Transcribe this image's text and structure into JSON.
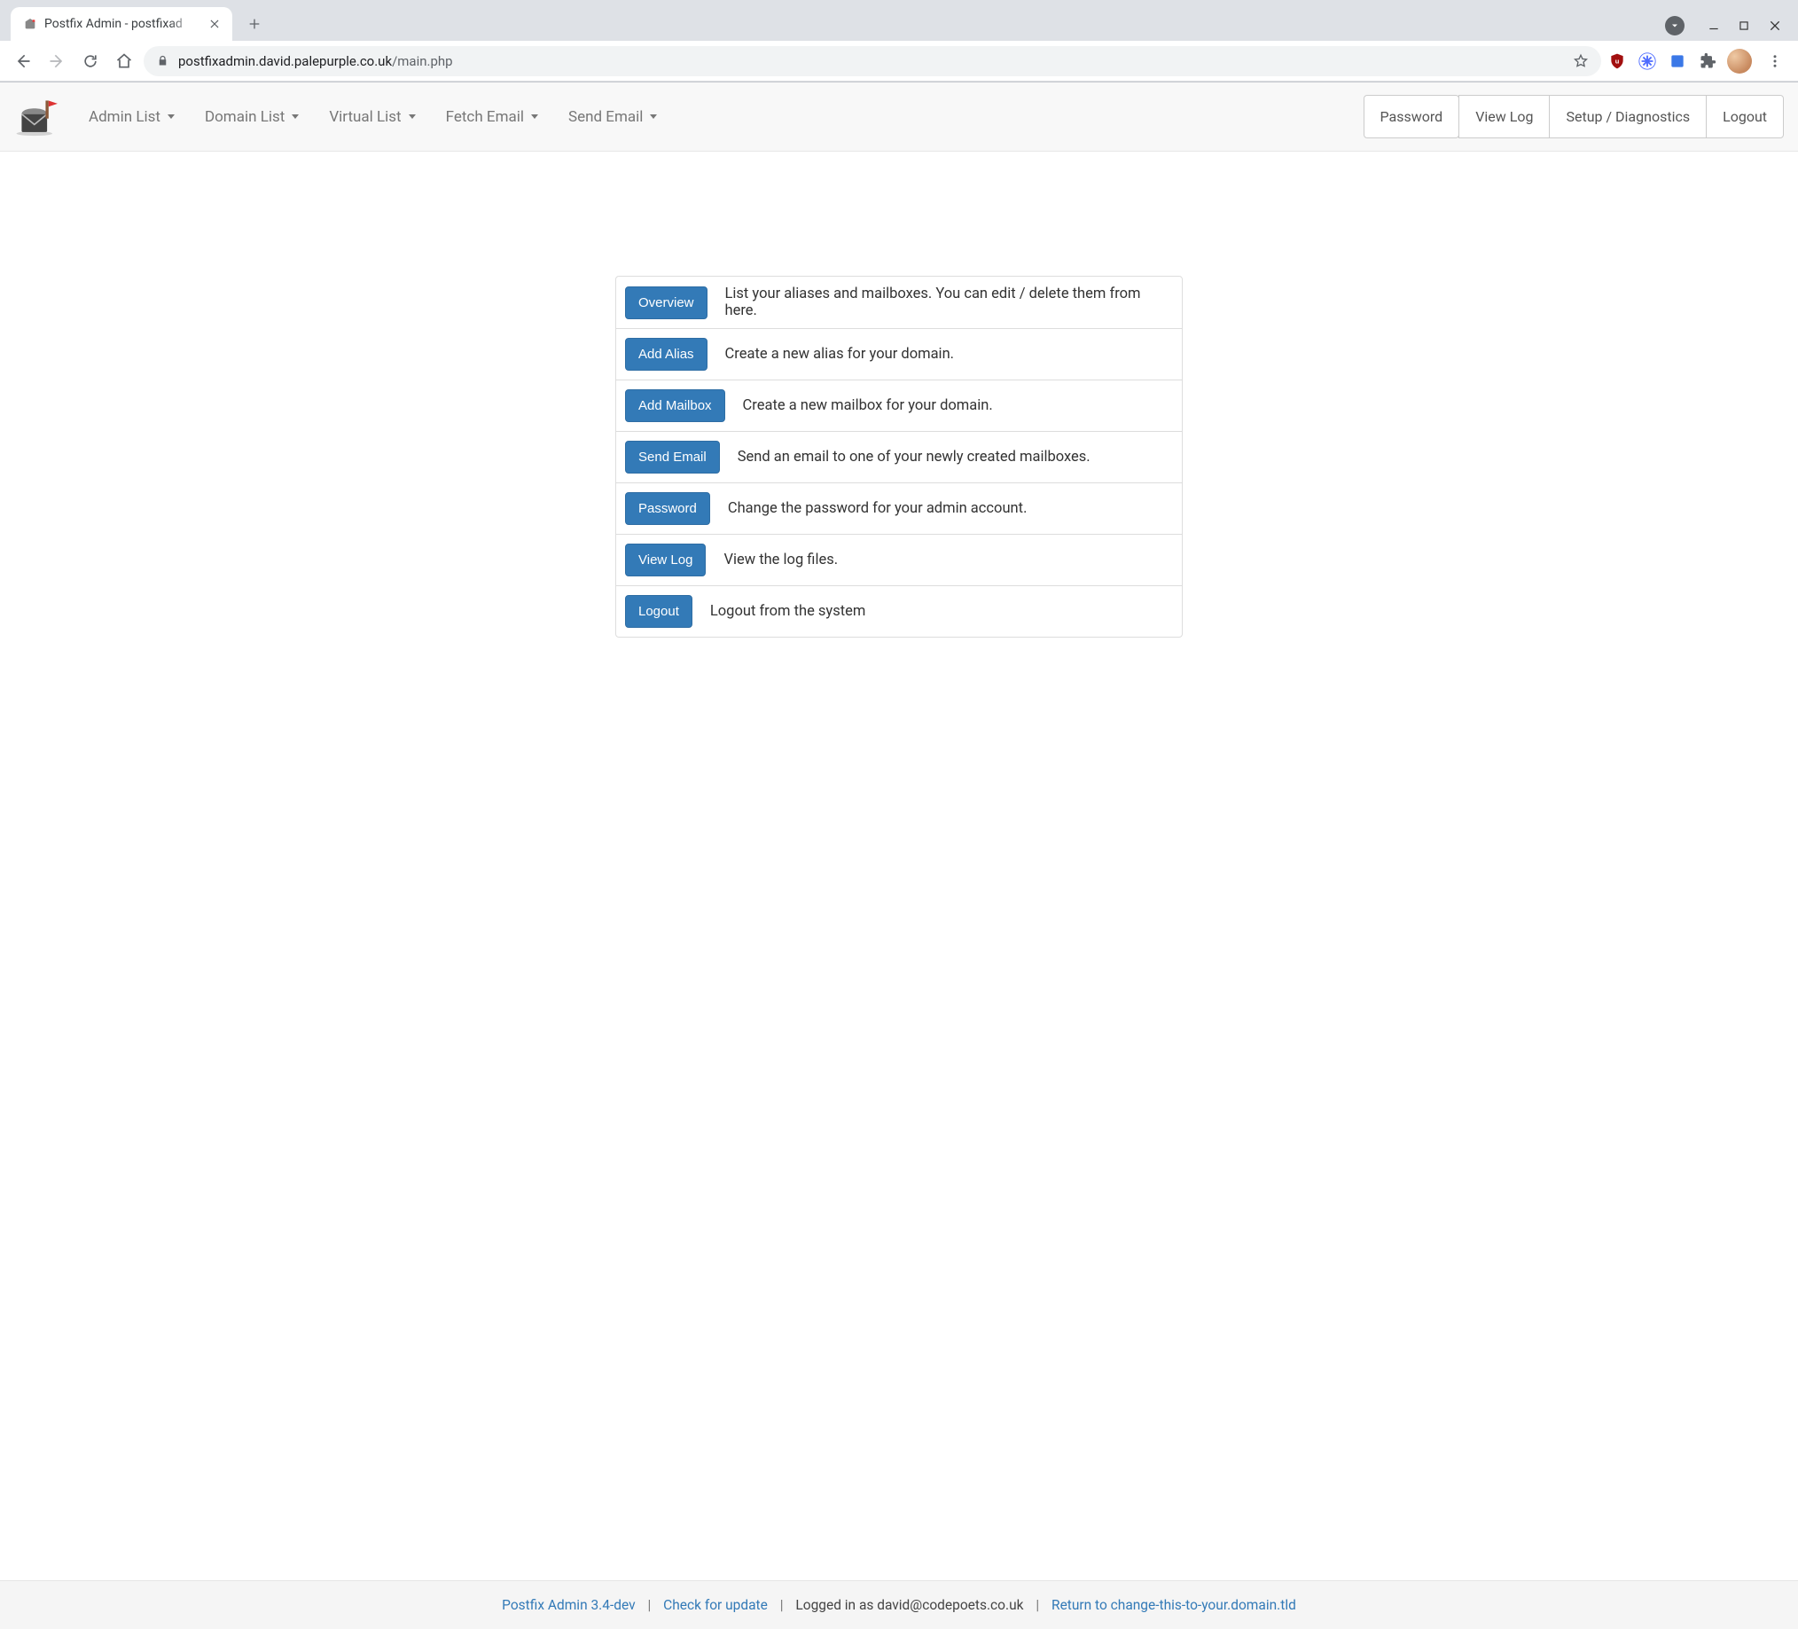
{
  "browser": {
    "tab_title": "Postfix Admin - postfixad",
    "url_host": "postfixadmin.david.palepurple.co.uk",
    "url_path": "/main.php"
  },
  "navbar": {
    "items": [
      {
        "label": "Admin List"
      },
      {
        "label": "Domain List"
      },
      {
        "label": "Virtual List"
      },
      {
        "label": "Fetch Email"
      },
      {
        "label": "Send Email"
      }
    ],
    "buttons": [
      {
        "label": "Password"
      },
      {
        "label": "View Log"
      },
      {
        "label": "Setup / Diagnostics"
      },
      {
        "label": "Logout"
      }
    ]
  },
  "menu": [
    {
      "button": "Overview",
      "desc": "List your aliases and mailboxes. You can edit / delete them from here."
    },
    {
      "button": "Add Alias",
      "desc": "Create a new alias for your domain."
    },
    {
      "button": "Add Mailbox",
      "desc": "Create a new mailbox for your domain."
    },
    {
      "button": "Send Email",
      "desc": "Send an email to one of your newly created mailboxes."
    },
    {
      "button": "Password",
      "desc": "Change the password for your admin account."
    },
    {
      "button": "View Log",
      "desc": "View the log files."
    },
    {
      "button": "Logout",
      "desc": "Logout from the system"
    }
  ],
  "footer": {
    "version_link": "Postfix Admin 3.4-dev",
    "check_update": "Check for update",
    "logged_in_as": "Logged in as david@codepoets.co.uk",
    "return_link": "Return to change-this-to-your.domain.tld"
  }
}
